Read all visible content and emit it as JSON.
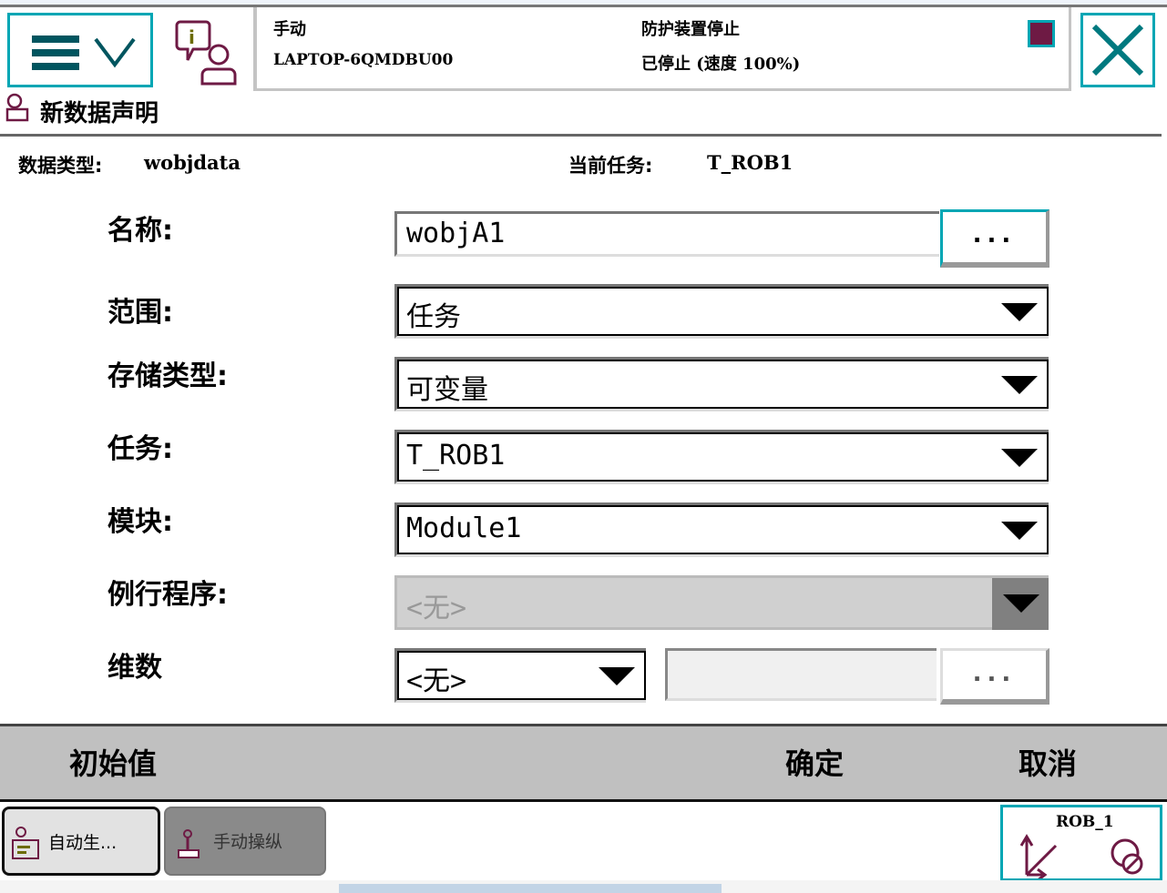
{
  "header": {
    "mode": "手动",
    "controller": "LAPTOP-6QMDBU00",
    "safety": "防护装置停止",
    "state": "已停止 (速度 100%)"
  },
  "page": {
    "title": "新数据声明",
    "data_type_label": "数据类型:",
    "data_type": "wobjdata",
    "current_task_label": "当前任务:",
    "current_task": "T_ROB1"
  },
  "form": {
    "name": {
      "label": "名称:",
      "value": "wobjA1",
      "button": "..."
    },
    "scope": {
      "label": "范围:",
      "value": "任务"
    },
    "storage": {
      "label": "存储类型:",
      "value": "可变量"
    },
    "task": {
      "label": "任务:",
      "value": "T_ROB1"
    },
    "module": {
      "label": "模块:",
      "value": "Module1"
    },
    "routine": {
      "label": "例行程序:",
      "value": "<无>"
    },
    "dimension": {
      "label": "维数",
      "value": "<无>",
      "text": "",
      "button": "..."
    }
  },
  "actions": {
    "initial": "初始值",
    "ok": "确定",
    "cancel": "取消"
  },
  "taskbar": {
    "items": [
      {
        "label": "自动生..."
      },
      {
        "label": "手动操纵"
      }
    ],
    "robot": "ROB_1"
  }
}
